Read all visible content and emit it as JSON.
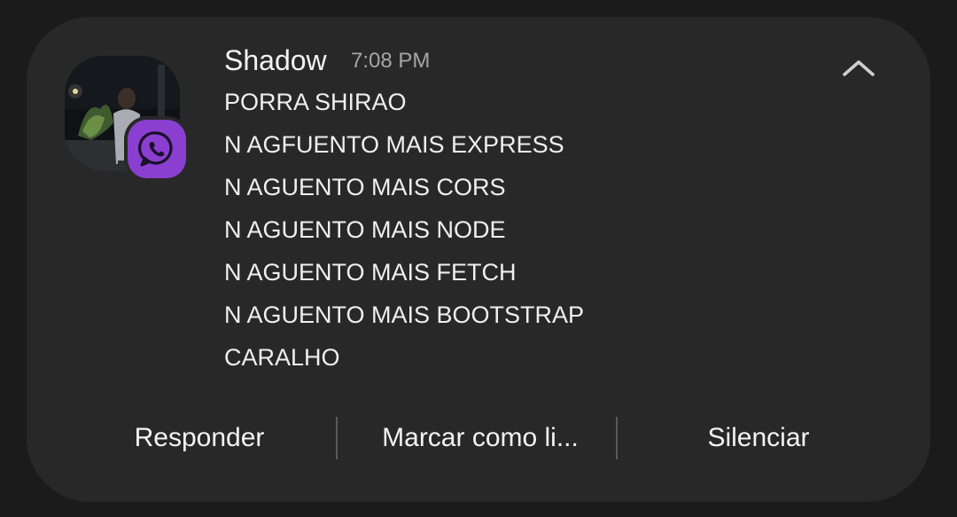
{
  "notification": {
    "sender": "Shadow",
    "time": "7:08 PM",
    "messages": [
      "PORRA SHIRAO",
      "N AGFUENTO MAIS EXPRESS",
      "N AGUENTO MAIS CORS",
      "N AGUENTO MAIS NODE",
      "N AGUENTO MAIS FETCH",
      "N AGUENTO MAIS BOOTSTRAP",
      "CARALHO"
    ],
    "app_badge_icon": "whatsapp-icon",
    "collapse_icon": "chevron-up-icon",
    "badge_color": "#8a3fd0"
  },
  "actions": {
    "reply": "Responder",
    "mark_read": "Marcar como li...",
    "mute": "Silenciar"
  }
}
